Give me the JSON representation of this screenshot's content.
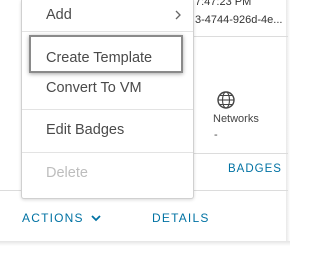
{
  "background": {
    "vm_time_partial": "7:47:23 PM",
    "vm_uuid_partial": "3-4744-926d-4e...",
    "networks_label": "Networks",
    "networks_value": "-",
    "badges_link": "BADGES",
    "actions_label": "ACTIONS",
    "details_label": "DETAILS"
  },
  "menu": {
    "items": [
      {
        "label": "Add",
        "has_submenu": true,
        "enabled": true
      },
      {
        "label": "Create Template",
        "has_submenu": false,
        "enabled": true,
        "highlighted": true
      },
      {
        "label": "Convert To VM",
        "has_submenu": false,
        "enabled": true
      },
      {
        "label": "Edit Badges",
        "has_submenu": false,
        "enabled": true
      },
      {
        "label": "Delete",
        "has_submenu": false,
        "enabled": false
      }
    ]
  },
  "icons": {
    "submenu": "chevron-right-icon",
    "actions_caret": "chevron-down-icon",
    "networks": "network-globe-icon"
  },
  "colors": {
    "link": "#0072a3",
    "menu_text": "#4a4a4a",
    "disabled_text": "#bdbdbd"
  }
}
